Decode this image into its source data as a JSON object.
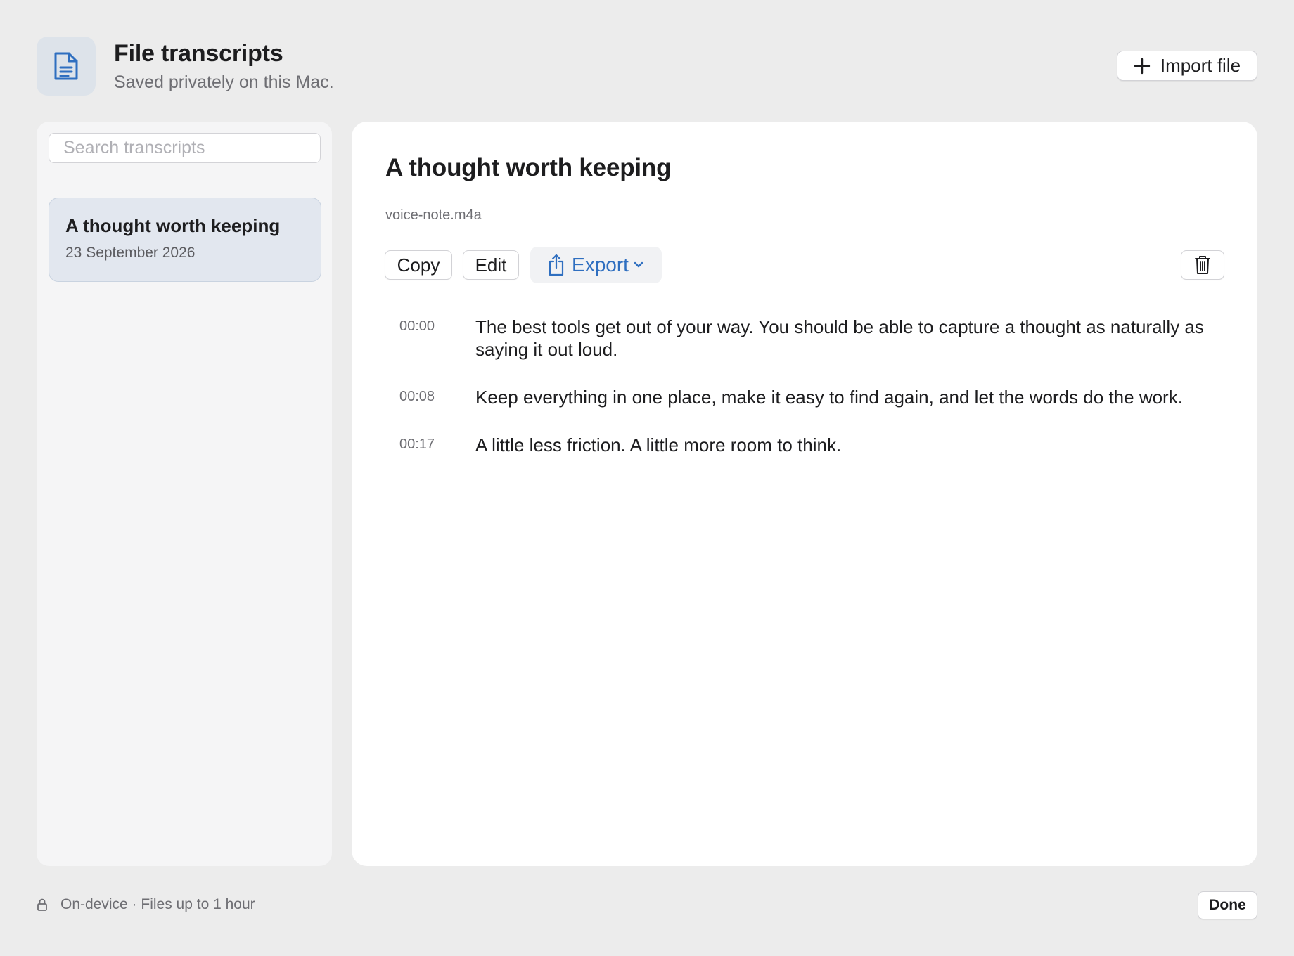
{
  "header": {
    "title": "File transcripts",
    "subtitle": "Saved privately on this Mac.",
    "icon": "document-icon",
    "import_label": "Import file"
  },
  "sidebar": {
    "search_placeholder": "Search transcripts",
    "items": [
      {
        "title": "A thought worth keeping",
        "date": "23 September 2026",
        "selected": true
      }
    ]
  },
  "detail": {
    "title": "A thought worth keeping",
    "filename": "voice-note.m4a",
    "toolbar": {
      "copy_label": "Copy",
      "edit_label": "Edit",
      "export_label": "Export"
    },
    "segments": [
      {
        "time": "00:00",
        "text": "The best tools get out of your way. You should be able to capture a thought as naturally as saying it out loud."
      },
      {
        "time": "00:08",
        "text": "Keep everything in one place, make it easy to find again, and let the words do the work."
      },
      {
        "time": "00:17",
        "text": "A little less friction. A little more room to think."
      }
    ]
  },
  "footer": {
    "status": "On-device · Files up to 1 hour",
    "done_label": "Done"
  },
  "colors": {
    "accent": "#2f6fc0",
    "window_bg": "#ececec",
    "selected_item_bg": "#e2e7ef"
  }
}
